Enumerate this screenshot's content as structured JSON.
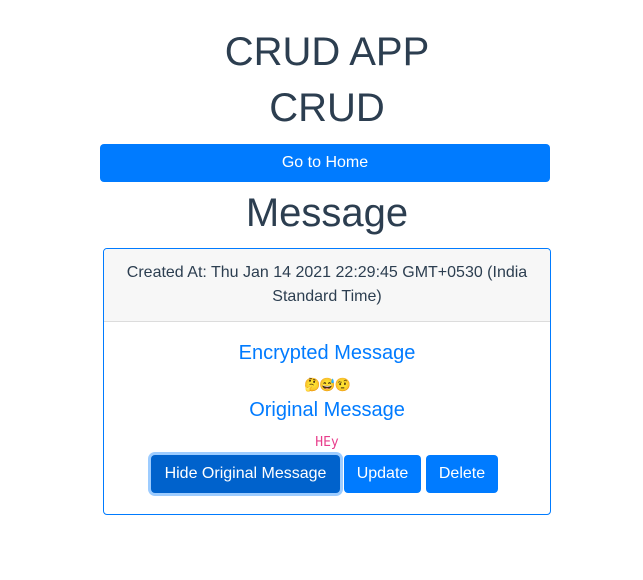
{
  "header": {
    "app_title": "CRUD APP",
    "section_title": "CRUD",
    "home_button": "Go to Home"
  },
  "message": {
    "page_title": "Message",
    "created_at": "Created At: Thu Jan 14 2021 22:29:45 GMT+0530 (India Standard Time)",
    "encrypted_label": "Encrypted Message",
    "encrypted_value": "🤔😅🤨",
    "original_label": "Original Message",
    "original_value": "HEy",
    "buttons": {
      "hide_original": "Hide Original Message",
      "update": "Update",
      "delete": "Delete"
    }
  },
  "colors": {
    "primary": "#007bff",
    "primary_active": "#0062cc",
    "heading": "#2c3e50",
    "code": "#e83e8c",
    "card_header_bg": "#f7f7f7"
  }
}
